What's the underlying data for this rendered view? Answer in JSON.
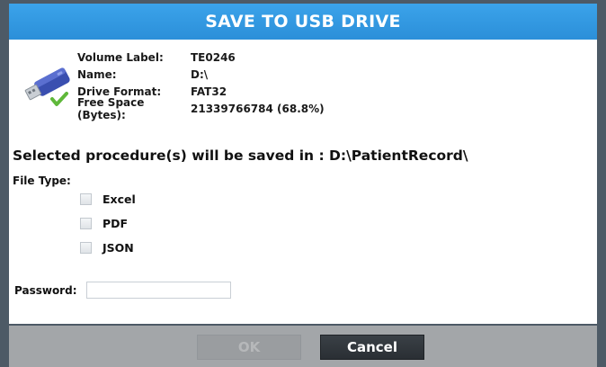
{
  "dialog": {
    "title": "SAVE TO USB DRIVE"
  },
  "drive_info": {
    "icon": "usb-drive-icon",
    "volume_label_key": "Volume Label:",
    "volume_label_value": "TE0246",
    "name_key": "Name:",
    "name_value": "D:\\",
    "format_key": "Drive Format:",
    "format_value": "FAT32",
    "free_space_key": "Free Space (Bytes):",
    "free_space_value": "21339766784 (68.8%)"
  },
  "save_message": "Selected procedure(s) will be saved in : D:\\PatientRecord\\",
  "file_type": {
    "label": "File Type:",
    "options": [
      {
        "label": "Excel",
        "checked": false
      },
      {
        "label": "PDF",
        "checked": false
      },
      {
        "label": "JSON",
        "checked": false
      }
    ]
  },
  "password": {
    "label": "Password:",
    "value": ""
  },
  "buttons": {
    "ok_label": "OK",
    "ok_enabled": false,
    "cancel_label": "Cancel"
  },
  "colors": {
    "title_bar": "#2b8fd9",
    "frame": "#4d5a66",
    "footer": "#a3a6a9",
    "cancel_button": "#2f353a",
    "usb_body": "#3a4fb0",
    "check_accent": "#5fb83a"
  }
}
